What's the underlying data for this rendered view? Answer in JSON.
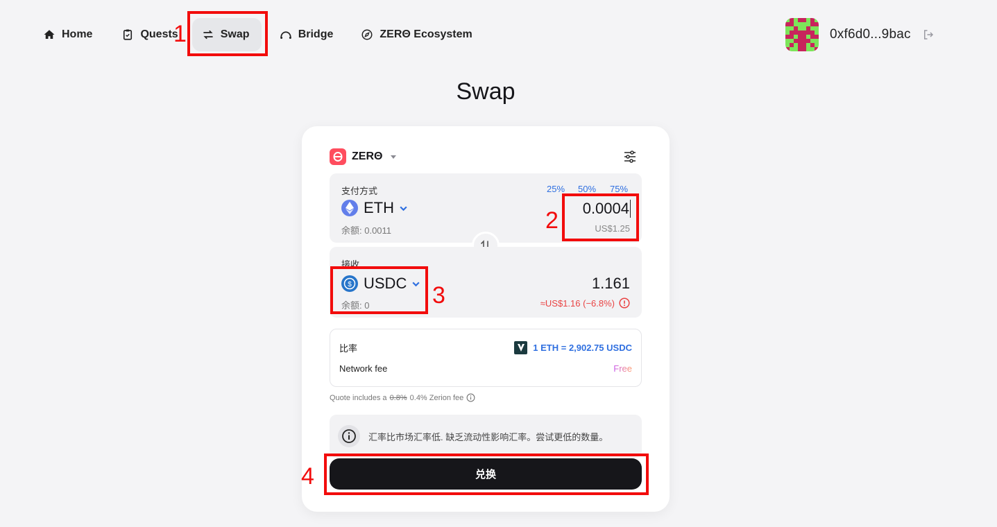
{
  "nav": {
    "items": [
      {
        "label": "Home",
        "icon": "home-icon"
      },
      {
        "label": "Quests",
        "icon": "clipboard-icon"
      },
      {
        "label": "Swap",
        "icon": "swap-arrows-icon",
        "active": true
      },
      {
        "label": "Bridge",
        "icon": "bridge-icon"
      },
      {
        "label": "ZERΘ Ecosystem",
        "icon": "compass-icon"
      }
    ]
  },
  "account": {
    "address": "0xf6d0...9bac"
  },
  "page": {
    "title": "Swap"
  },
  "swap": {
    "network": "ZERΘ",
    "pay": {
      "label": "支付方式",
      "percents": [
        "25%",
        "50%",
        "75%"
      ],
      "token": "ETH",
      "balance": "余额: 0.0011",
      "amount": "0.0004",
      "usd": "US$1.25"
    },
    "receive": {
      "label": "接收",
      "token": "USDC",
      "balance": "余额: 0",
      "amount": "1.161",
      "usd": "≈US$1.16 (−6.8%)"
    },
    "details": {
      "rate_label": "比率",
      "rate_value": "1 ETH = 2,902.75 USDC",
      "fee_label": "Network fee",
      "fee_value": "Free"
    },
    "quote_note": {
      "prefix": "Quote includes a",
      "old_fee": "0.8%",
      "new_fee": "0.4% Zerion fee"
    },
    "notice": "汇率比市场汇率低. 缺乏流动性影响汇率。尝试更低的数量。",
    "submit_label": "兑换"
  },
  "annotations": [
    "1",
    "2",
    "3",
    "4"
  ],
  "colors": {
    "accent_blue": "#2f6fe0",
    "warning_red": "#e94343",
    "annotation_red": "#f20c0c",
    "network_logo": "#ff4d5e"
  }
}
